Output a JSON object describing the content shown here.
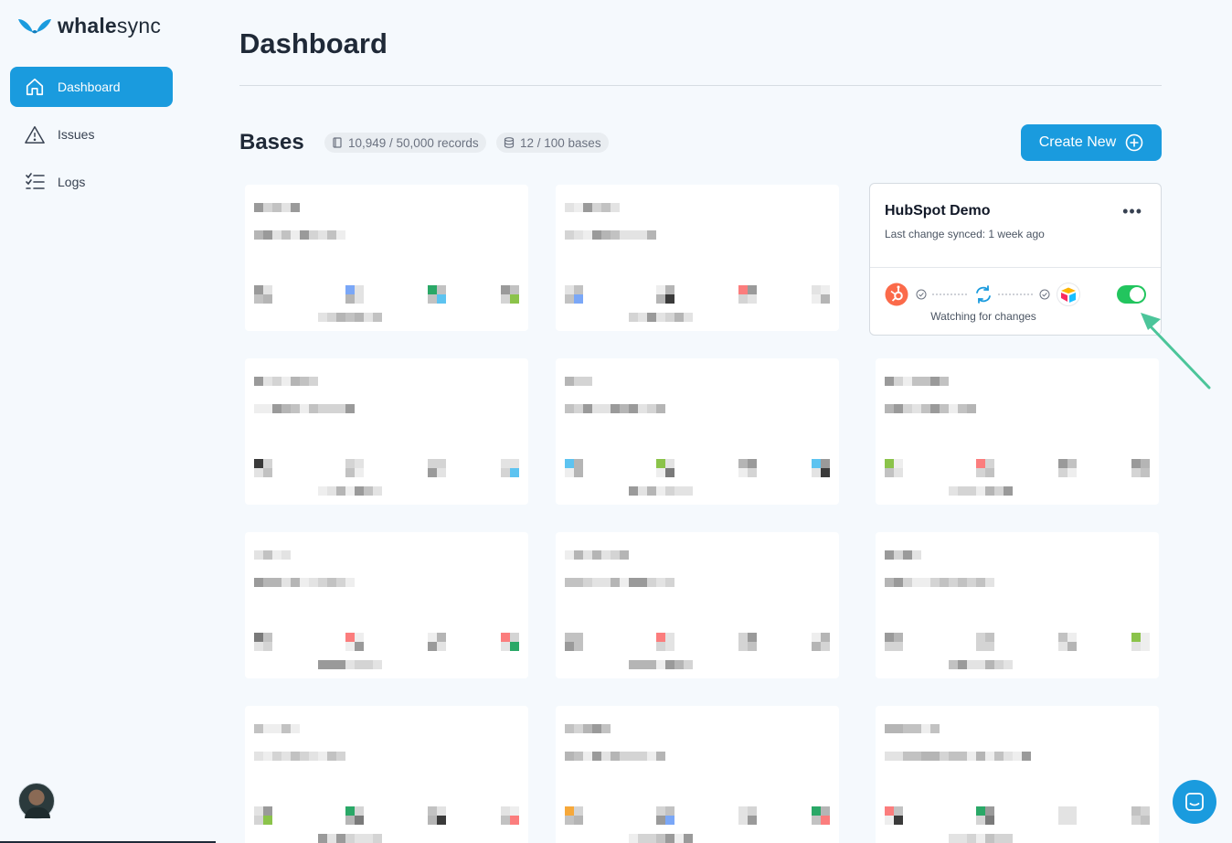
{
  "brand": {
    "name_prefix": "whale",
    "name_suffix": "sync",
    "accent": "#1a9bde"
  },
  "sidebar": {
    "items": [
      {
        "label": "Dashboard",
        "icon": "home-icon",
        "active": true
      },
      {
        "label": "Issues",
        "icon": "warning-icon",
        "active": false
      },
      {
        "label": "Logs",
        "icon": "list-check-icon",
        "active": false
      }
    ]
  },
  "page": {
    "title": "Dashboard"
  },
  "bases": {
    "title": "Bases",
    "records": "10,949 / 50,000 records",
    "count": "12 / 100 bases",
    "create_label": "Create New"
  },
  "featured_card": {
    "name": "HubSpot Demo",
    "last_sync": "Last change synced: 1 week ago",
    "status": "Watching for changes",
    "toggle_on": true,
    "left_app_icon": "hubspot-icon",
    "right_app_icon": "airtable-icon"
  }
}
